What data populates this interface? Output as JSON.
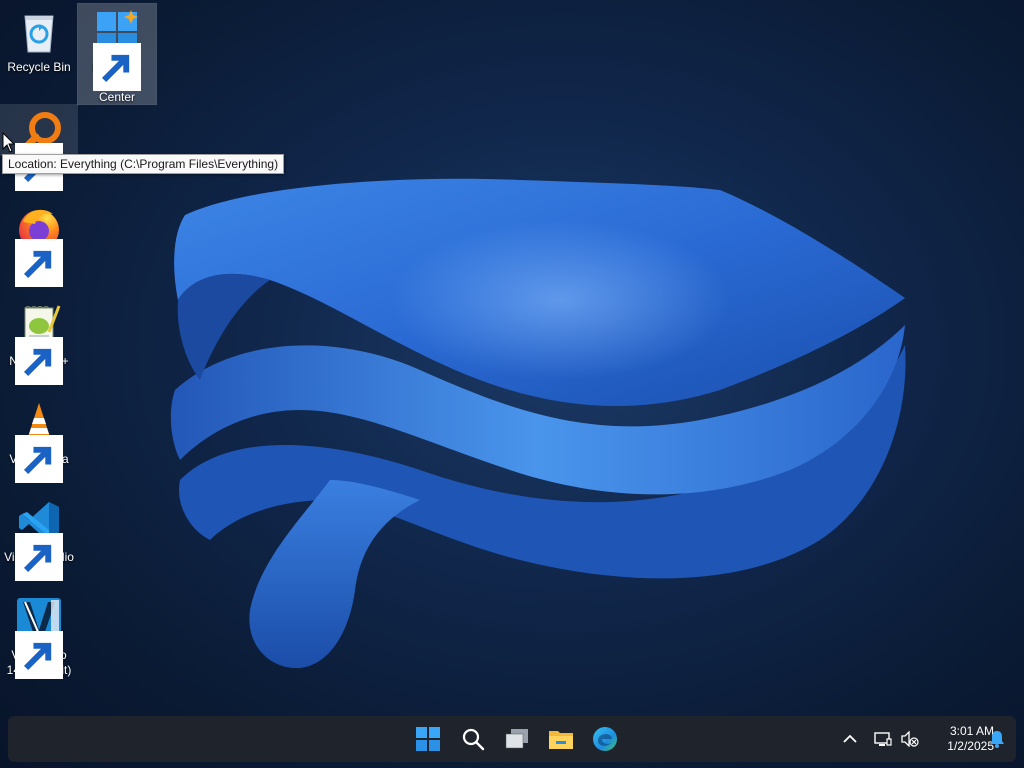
{
  "desktop": {
    "icons": [
      {
        "label": "Recycle Bin",
        "icon": "recycle-bin-icon",
        "shortcut": false
      },
      {
        "label": "Rectify11 Control Center",
        "icon": "rectify11-icon",
        "shortcut": true,
        "selected": true
      },
      {
        "label": "",
        "icon": "everything-search-icon",
        "shortcut": true,
        "hover": true
      },
      {
        "label": "Firefox",
        "icon": "firefox-icon",
        "shortcut": true
      },
      {
        "label": "Notepad++",
        "icon": "notepad-plus-plus-icon",
        "shortcut": true
      },
      {
        "label": "VLC media player",
        "icon": "vlc-icon",
        "shortcut": true
      },
      {
        "label": "Visual Studio Code",
        "icon": "vscode-icon",
        "shortcut": true
      },
      {
        "label": "Vegas Pro 14.0 (64-bit)",
        "icon": "vegas-pro-icon",
        "shortcut": true
      }
    ]
  },
  "tooltip": {
    "text": "Location: Everything (C:\\Program Files\\Everything)"
  },
  "taskbar": {
    "apps": [
      {
        "name": "Start",
        "icon": "windows-start-icon"
      },
      {
        "name": "Search",
        "icon": "search-icon"
      },
      {
        "name": "Task View",
        "icon": "task-view-icon"
      },
      {
        "name": "File Explorer",
        "icon": "file-explorer-icon"
      },
      {
        "name": "Microsoft Edge",
        "icon": "edge-icon"
      }
    ],
    "tray": {
      "time": "3:01 AM",
      "date": "1/2/2025",
      "icons": [
        "chevron-up-icon",
        "network-icon",
        "volume-muted-icon",
        "notification-bell-icon"
      ]
    }
  },
  "colors": {
    "accent": "#0078d4",
    "taskbar": "#20242c",
    "wallpaper_blue": "#2d6fd0"
  }
}
